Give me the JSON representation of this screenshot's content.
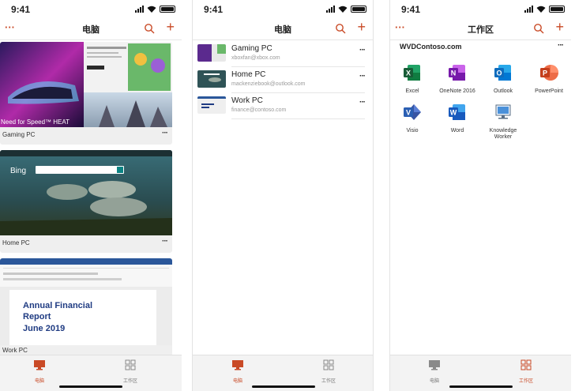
{
  "status_time": "9:41",
  "tabs": {
    "pc": "电脑",
    "workspace": "工作区"
  },
  "screen1": {
    "title": "电脑",
    "cards": [
      {
        "label": "Gaming PC"
      },
      {
        "label": "Home PC"
      },
      {
        "label": "Work PC"
      }
    ],
    "gaming_text": "Need for Speed™ HEAT",
    "bing_text": "Bing",
    "word_lines": [
      "Annual Financial",
      "Report",
      "June 2019"
    ]
  },
  "screen2": {
    "title": "电脑",
    "rows": [
      {
        "name": "Gaming PC",
        "email": "xboxfan@xbox.com"
      },
      {
        "name": "Home PC",
        "email": "mackenziebook@outlook.com"
      },
      {
        "name": "Work PC",
        "email": "finance@contoso.com"
      }
    ]
  },
  "screen3": {
    "title": "工作区",
    "workspace": "WVDContoso.com",
    "apps": [
      {
        "label": "Excel",
        "icon": "excel-icon",
        "color": "#1e7145"
      },
      {
        "label": "OneNote 2016",
        "icon": "onenote-icon",
        "color": "#7719aa"
      },
      {
        "label": "Outlook",
        "icon": "outlook-icon",
        "color": "#0f6cbd"
      },
      {
        "label": "PowerPoint",
        "icon": "powerpoint-icon",
        "color": "#c43e1c"
      },
      {
        "label": "Visio",
        "icon": "visio-icon",
        "color": "#2b5fb3"
      },
      {
        "label": "Word",
        "icon": "word-icon",
        "color": "#185abd"
      },
      {
        "label": "Knowledge Worker",
        "icon": "desktop-icon",
        "color": "#4a90d9"
      }
    ]
  },
  "accent": "#c94a26"
}
